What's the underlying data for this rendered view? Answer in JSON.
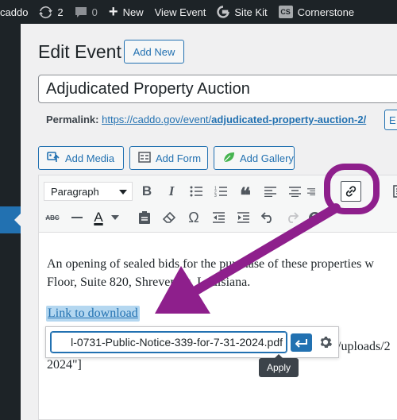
{
  "admin_bar": {
    "site_name": "caddo",
    "updates_count": "2",
    "comments_count": "0",
    "new_label": "New",
    "view_label": "View Event",
    "sitekit_label": "Site Kit",
    "cornerstone_badge": "CS",
    "cornerstone_label": "Cornerstone"
  },
  "page": {
    "title": "Edit Event",
    "add_new_label": "Add New",
    "post_title": "Adjudicated Property Auction",
    "permalink_label": "Permalink:",
    "permalink_base": "https://caddo.gov/event/",
    "permalink_slug": "adjudicated-property-auction-2/",
    "edit_slug_label": "E"
  },
  "media_buttons": {
    "add_media": "Add Media",
    "add_form": "Add Form",
    "add_gallery": "Add Gallery"
  },
  "toolbar": {
    "format_value": "Paragraph",
    "icons": [
      "bold-icon",
      "italic-icon",
      "bullet-list-icon",
      "numbered-list-icon",
      "blockquote-icon",
      "align-left-icon",
      "align-center-icon",
      "align-right-icon",
      "link-icon",
      "toolbar-toggle-icon",
      "strikethrough-icon",
      "horizontal-line-icon",
      "text-color-icon",
      "paste-text-icon",
      "clear-formatting-icon",
      "special-character-icon",
      "outdent-icon",
      "indent-icon",
      "undo-icon",
      "redo-icon",
      "help-icon"
    ],
    "bold_glyph": "B",
    "italic_glyph": "I",
    "strike_glyph": "ABC",
    "color_glyph": "A",
    "omega_glyph": "Ω",
    "help_glyph": "?"
  },
  "editor": {
    "paragraph_line1": "An opening of sealed bids for the purchase of these properties w",
    "paragraph_line2": "Floor, Suite 820, Shreveport, Louisiana.",
    "link_text": "Link to download",
    "shortcode_line1": "/uploads/2",
    "shortcode_line2": "2024\"]",
    "link_url_value": "l-0731-Public-Notice-339-for-7-31-2024.pdf",
    "apply_tooltip": "Apply"
  },
  "colors": {
    "admin_bar": "#1d2327",
    "accent_blue": "#2271b1",
    "annotation_purple": "#8e1f8c"
  }
}
